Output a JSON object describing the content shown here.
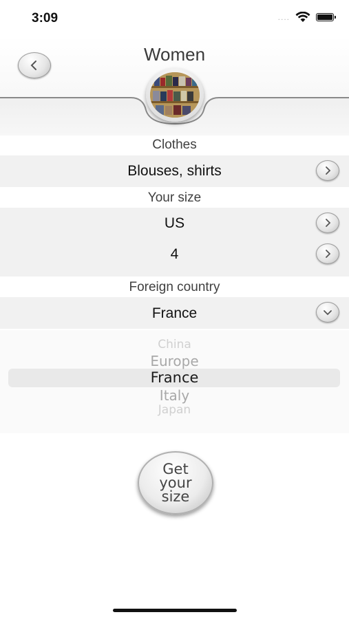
{
  "status_bar": {
    "time": "3:09",
    "signal": "....",
    "icons": [
      "wifi-icon",
      "battery-icon"
    ]
  },
  "header": {
    "title": "Women",
    "back_icon": "chevron-left-icon",
    "emblem": "clothing-shelf-image"
  },
  "clothes": {
    "label": "Clothes",
    "value": "Blouses, shirts",
    "icon": "chevron-right-icon"
  },
  "size": {
    "label": "Your size",
    "system": "US",
    "value": "4",
    "icon": "chevron-right-icon"
  },
  "country": {
    "label": "Foreign country",
    "value": "France",
    "icon": "chevron-down-icon"
  },
  "picker": {
    "options": [
      "China",
      "Europe",
      "France",
      "Italy",
      "Japan"
    ],
    "selected": "France"
  },
  "action": {
    "label": "Get\nyour\nsize"
  },
  "colors": {
    "row_bg": "#f1f1f1",
    "text": "#1a1a1a",
    "muted": "#3f3f3f"
  }
}
